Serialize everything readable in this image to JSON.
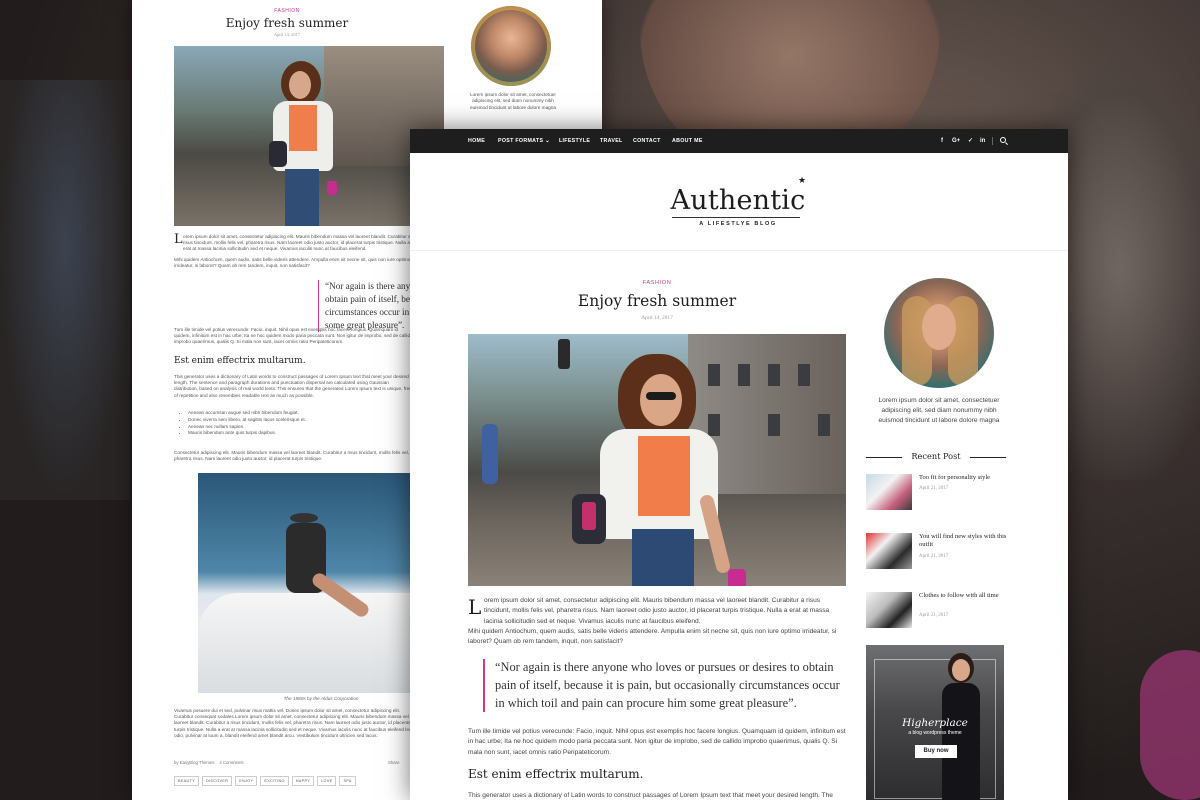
{
  "article": {
    "category": "FASHION",
    "title": "Enjoy fresh summer",
    "date": "April 14, 2017",
    "dropcap": "L",
    "para1": "orem ipsum dolor sit amet, consectetur adipiscing elit. Mauris bibendum massa vel laoreet blandit. Curabitur a risus tincidunt, mollis felis vel, pharetra risus. Nam laoreet odio justo auctor, id placerat turpis tristique. Nulla a erat at massa lacinia sollicitudin sed et neque. Vivamus iaculis nunc at faucibus eleifend.",
    "para2": "Mihi quidem Antiochum, quem audis, satis belle videris attendere. Ampulla enim sit necne sit, quis non iure optimo irrideatur, si laboret? Quam ob rem tandem, inquit, non satisfacit?",
    "quote": "“Nor again is there anyone who loves or pursues or desires to obtain pain of itself, because it is pain, but occasionally circumstances occur in which toil and pain can procure him some great pleasure”.",
    "para3": "Tum ille timide vel potius verecunde: Facio, inquit. Nihil opus est exemplis hoc facere longius. Quamquam id quidem, infinitum est in hac urbe; Ita ne hoc quidem modo paria peccata sunt. Non igitur de improbo, sed de callido improbo quaerimus, qualis Q. Si mala non sunt, iacet omnis ratio Peripateticorum.",
    "heading": "Est enim effectrix multarum.",
    "para4": "This generator uses a dictionary of Latin words to construct passages of Lorem Ipsum text that meet your desired length. The sentence and paragraph durations and punctuation dispersal are calculated using Gaussian distribution, based on analysis of real world texts. This ensures that the generated Lorem Ipsum text is unique, free of repetition and also resembles readable text as much as possible.",
    "bullets": [
      "Aenean accumsan augue sed nibh bibendum feugiat.",
      "Donec viverra sem libero, at sagittis lacus scelerisque et.",
      "Aenean nec nullam sapien.",
      "Mauris bibendum ante quis turpis dapibus."
    ],
    "para5": "Consectetur adipiscing elit. Mauris bibendum massa vel laoreet blandit. Curabitur a risus tincidunt, mollis felis vel, pharetra risus. Nam laoreet odio justo auctor, id placerat turpis tristique.",
    "caption": "The 1980s by the Aldus Corporation",
    "para6": "Vivamus posuere dui et sed, pulvinar risus mattis vel. Donec ipsum dolor sit amet, consectetur adipiscing elit. Curabitur consequat sodales.Lorem ipsum dolor sit amet, consectetur adipiscing elit. Mauris bibendum massa vel laoreet blandit. Curabitur a risus tincidunt, mollis felis vel, pharetra risus. Nam laoreet odio justo auctor, id placerat turpis tristique. Nulla a erat at massa lacinia sollicitudin sed et neque. Vivamus iaculis nunc at faucibus eleifend leo odio, pulvinar at luum a, blandit eleifend amet blandit arcu. Vestibulum tincidunt ultricies sed lacus.",
    "author_line": "by EasyBlog Themes",
    "comments": "4 Comments",
    "share_label": "Share",
    "tags": [
      "BEAUTY",
      "DISCOVER",
      "ENJOY",
      "EXCITING",
      "HAPPY",
      "LOVE",
      "SPA"
    ]
  },
  "nav": {
    "items": [
      "HOME",
      "POST FORMATS",
      "LIFESTYLE",
      "TRAVEL",
      "CONTACT",
      "ABOUT ME"
    ],
    "dropdown_glyph": "⌄",
    "social": [
      "f",
      "G+",
      "✓",
      "in"
    ]
  },
  "brand": {
    "logo": "Authentic",
    "star": "★",
    "tagline": "A LIFESTLYE BLOG"
  },
  "sidebar": {
    "bio": "Lorem ipsum dolor sit amet, consectetuer adipiscing elit, sed diam nonummy nibh euismod tincidunt ut labore dolore magna",
    "recent_title": "Recent Post",
    "recent": [
      {
        "title": "Too fit for personality style",
        "date": "April 21, 2017"
      },
      {
        "title": "You will find new styles with this outfit",
        "date": "April 21, 2017"
      },
      {
        "title": "Clothes to follow with all time",
        "date": "April 21, 2017"
      }
    ],
    "ad": {
      "name": "Higherplace",
      "sub": "a blog wordpress theme",
      "button": "Buy now"
    }
  },
  "colors": {
    "accent": "#d0368a",
    "nav_bg": "#1e1e1e"
  }
}
